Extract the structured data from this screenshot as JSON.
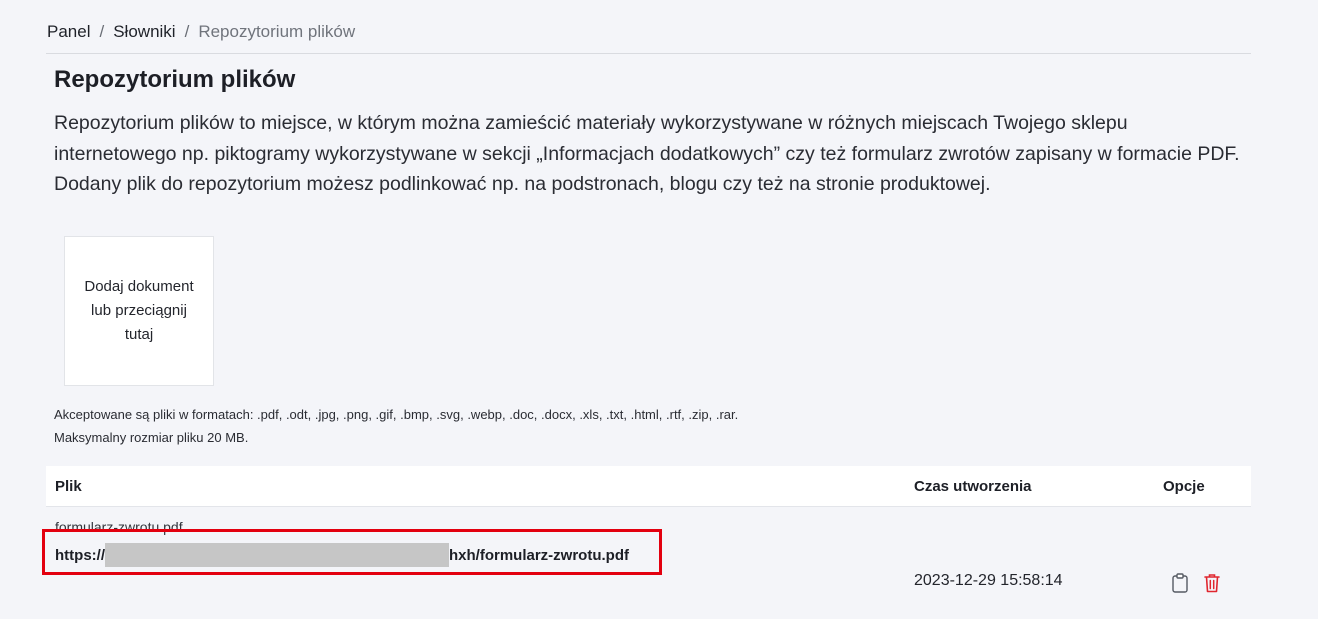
{
  "breadcrumb": {
    "items": [
      "Panel",
      "Słowniki",
      "Repozytorium plików"
    ],
    "separator": "/"
  },
  "page": {
    "title": "Repozytorium plików",
    "description": "Repozytorium plików to miejsce, w którym można zamieścić materiały wykorzystywane w różnych miejscach Twojego sklepu internetowego np. piktogramy wykorzystywane w sekcji „Informacjach dodatkowych” czy też formularz zwrotów zapisany w formacie PDF. Dodany plik do repozytorium możesz podlinkować np. na podstronach, blogu czy też na stronie produktowej."
  },
  "upload": {
    "label": "Dodaj dokument lub przeciągnij tutaj",
    "formats_note": "Akceptowane są pliki w formatach: .pdf, .odt, .jpg, .png, .gif, .bmp, .svg, .webp, .doc, .docx, .xls, .txt, .html, .rtf, .zip, .rar.",
    "size_note": "Maksymalny rozmiar pliku 20 MB."
  },
  "table": {
    "headers": {
      "file": "Plik",
      "created": "Czas utworzenia",
      "options": "Opcje"
    },
    "rows": [
      {
        "file_name": "formularz-zwrotu.pdf",
        "url_prefix": "https://",
        "url_suffix": "hxh/formularz-zwrotu.pdf",
        "created": "2023-12-29 15:58:14"
      }
    ]
  },
  "icons": {
    "copy": "clipboard-icon",
    "delete": "trash-icon"
  },
  "colors": {
    "delete_icon": "#e0262f",
    "highlight": "#e3000f",
    "redaction": "#c6c6c6"
  }
}
